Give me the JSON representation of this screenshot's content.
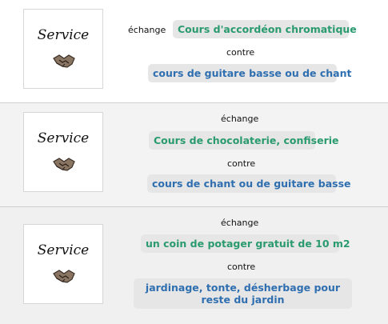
{
  "listings": [
    {
      "thumb_label": "Service",
      "exchange_label": "échange",
      "offer": "Cours d'accordéon chromatique",
      "contre_label": "contre",
      "want": "cours de guitare basse ou de chant"
    },
    {
      "thumb_label": "Service",
      "exchange_label": "échange",
      "offer": "Cours de chocolaterie, confiserie",
      "contre_label": "contre",
      "want": "cours de chant ou de guitare basse"
    },
    {
      "thumb_label": "Service",
      "exchange_label": "échange",
      "offer": "un coin de potager gratuit de 10 m2",
      "contre_label": "contre",
      "want": "jardinage, tonte, désherbage pour reste du jardin"
    }
  ],
  "colors": {
    "offer_text": "#2a9a6f",
    "want_text": "#2f6fb0",
    "pill_bg": "#e6e6e6"
  },
  "icons": {
    "thumb_icon": "handshake-icon"
  }
}
